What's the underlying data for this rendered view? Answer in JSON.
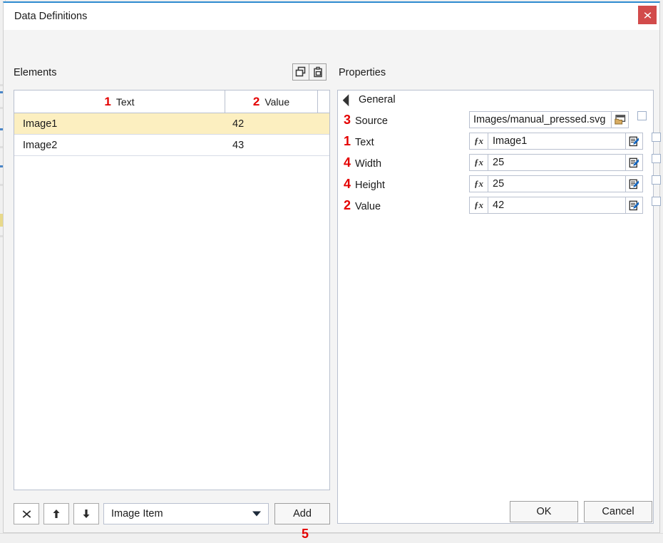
{
  "window": {
    "title": "Data Definitions",
    "close_label": "✕"
  },
  "left": {
    "section_label": "Elements",
    "copy_icon": "copy-icon",
    "paste_icon": "paste-icon",
    "columns": [
      {
        "annot": "1",
        "label": "Text"
      },
      {
        "annot": "2",
        "label": "Value"
      }
    ],
    "rows": [
      {
        "text": "Image1",
        "value": "42",
        "selected": true
      },
      {
        "text": "Image2",
        "value": "43",
        "selected": false
      }
    ],
    "toolbar": {
      "delete_icon": "✖",
      "move_up_icon": "↑",
      "move_down_icon": "↓",
      "type_value": "Image Item",
      "add_label": "Add",
      "add_annot": "5"
    }
  },
  "right": {
    "section_label": "Properties",
    "group_label": "General",
    "fx_label": "ƒx",
    "properties": [
      {
        "annot": "3",
        "label": "Source",
        "value": "Images/manual_pressed.svg",
        "kind": "source",
        "button_icon": "folder-browse-icon",
        "checked": false
      },
      {
        "annot": "1",
        "label": "Text",
        "value": "Image1",
        "kind": "fx",
        "button_icon": "edit-expression-icon",
        "checked": false
      },
      {
        "annot": "4",
        "label": "Width",
        "value": "25",
        "kind": "fx",
        "button_icon": "edit-expression-icon",
        "checked": false
      },
      {
        "annot": "4",
        "label": "Height",
        "value": "25",
        "kind": "fx",
        "button_icon": "edit-expression-icon",
        "checked": false
      },
      {
        "annot": "2",
        "label": "Value",
        "value": "42",
        "kind": "fx",
        "button_icon": "edit-expression-icon",
        "checked": false
      }
    ]
  },
  "footer": {
    "ok_label": "OK",
    "cancel_label": "Cancel"
  },
  "colors": {
    "accent": "#2e8bd0",
    "close": "#d24b4b",
    "selected_row": "#fcefc0",
    "annotation": "#e40000"
  }
}
